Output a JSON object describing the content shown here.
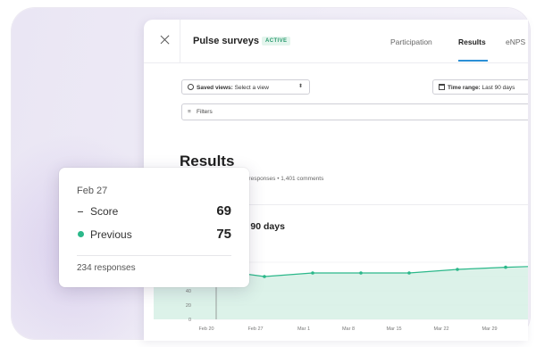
{
  "header": {
    "title": "Pulse surveys",
    "status_badge": "ACTIVE",
    "tabs": [
      {
        "label": "Participation",
        "active": false
      },
      {
        "label": "Results",
        "active": true
      },
      {
        "label": "eNPS",
        "active": false
      }
    ]
  },
  "toolbar": {
    "saved_views_label": "Saved views:",
    "saved_views_value": "Select a view",
    "time_range_label": "Time range:",
    "time_range_value": "Last 90 days",
    "filters_label": "Filters"
  },
  "results": {
    "title": "Results",
    "meta": "7 responses • 1,401 comments"
  },
  "chart": {
    "title_fragment": "t 90 days"
  },
  "chart_data": {
    "type": "area",
    "x": [
      "Feb 20",
      "Feb 27",
      "Mar 1",
      "Mar 8",
      "Mar 15",
      "Mar 22",
      "Mar 29"
    ],
    "series": [
      {
        "name": "Score",
        "values": [
          null,
          69,
          60,
          65,
          65,
          65,
          70,
          73
        ]
      }
    ],
    "y_ticks": [
      0,
      20,
      40
    ],
    "highlight_x": "Feb 27",
    "colors": {
      "line": "#2bb88a",
      "fill": "#d3efe4"
    }
  },
  "tooltip": {
    "date": "Feb 27",
    "rows": [
      {
        "label": "Score",
        "value": "69",
        "marker": "dash"
      },
      {
        "label": "Previous",
        "value": "75",
        "marker": "dot"
      }
    ],
    "responses": "234 responses"
  }
}
